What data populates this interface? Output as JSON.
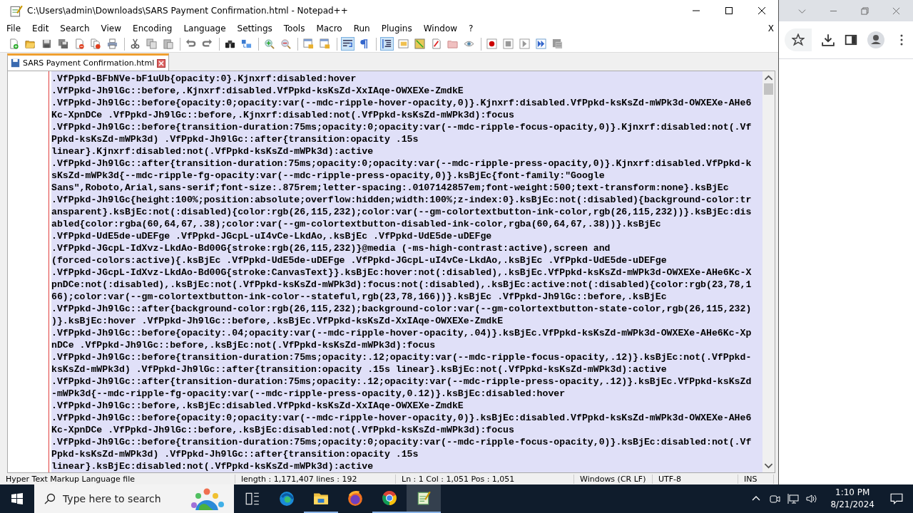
{
  "window": {
    "title": "C:\\Users\\admin\\Downloads\\SARS Payment Confirmation.html - Notepad++"
  },
  "menu": [
    "File",
    "Edit",
    "Search",
    "View",
    "Encoding",
    "Language",
    "Settings",
    "Tools",
    "Macro",
    "Run",
    "Plugins",
    "Window",
    "?"
  ],
  "menu_close": "X",
  "toolbar": [
    {
      "pressed": false
    },
    {
      "pressed": false
    },
    {
      "pressed": false
    },
    {
      "pressed": false
    },
    {
      "pressed": false
    },
    {
      "pressed": false
    },
    {
      "pressed": false
    },
    {
      "pressed": false
    },
    {
      "pressed": false
    },
    {
      "pressed": false
    },
    {
      "pressed": false
    },
    {
      "pressed": false
    },
    {
      "pressed": false
    },
    {
      "pressed": false
    },
    {
      "pressed": false
    },
    {
      "pressed": false
    },
    {
      "pressed": false
    },
    {
      "pressed": false
    },
    {
      "pressed": true
    },
    {
      "pressed": false
    },
    {
      "pressed": true
    },
    {
      "pressed": false
    },
    {
      "pressed": false
    },
    {
      "pressed": false
    },
    {
      "pressed": false
    },
    {
      "pressed": false
    },
    {
      "pressed": false
    },
    {
      "pressed": false
    },
    {
      "pressed": false
    },
    {
      "pressed": false
    },
    {
      "pressed": false
    }
  ],
  "tabs": [
    {
      "label": "SARS Payment Confirmation.html",
      "selected": true
    }
  ],
  "editor": {
    "selected": true,
    "lines": [
      ".VfPpkd-BFbNVe-bF1uUb{opacity:0}.Kjnxrf:disabled:hover",
      ".VfPpkd-Jh9lGc::before,.Kjnxrf:disabled.VfPpkd-ksKsZd-XxIAqe-OWXEXe-ZmdkE",
      ".VfPpkd-Jh9lGc::before{opacity:0;opacity:var(--mdc-ripple-hover-opacity,0)}.Kjnxrf:disabled.VfPpkd-ksKsZd-mWPk3d-OWXEXe-AHe6",
      "Kc-XpnDCe .VfPpkd-Jh9lGc::before,.Kjnxrf:disabled:not(.VfPpkd-ksKsZd-mWPk3d):focus",
      ".VfPpkd-Jh9lGc::before{transition-duration:75ms;opacity:0;opacity:var(--mdc-ripple-focus-opacity,0)}.Kjnxrf:disabled:not(.Vf",
      "Ppkd-ksKsZd-mWPk3d) .VfPpkd-Jh9lGc::after{transition:opacity .15s",
      "linear}.Kjnxrf:disabled:not(.VfPpkd-ksKsZd-mWPk3d):active",
      ".VfPpkd-Jh9lGc::after{transition-duration:75ms;opacity:0;opacity:var(--mdc-ripple-press-opacity,0)}.Kjnxrf:disabled.VfPpkd-k",
      "sKsZd-mWPk3d{--mdc-ripple-fg-opacity:var(--mdc-ripple-press-opacity,0)}.ksBjEc{font-family:\"Google",
      "Sans\",Roboto,Arial,sans-serif;font-size:.875rem;letter-spacing:.0107142857em;font-weight:500;text-transform:none}.ksBjEc",
      ".VfPpkd-Jh9lGc{height:100%;position:absolute;overflow:hidden;width:100%;z-index:0}.ksBjEc:not(:disabled){background-color:tr",
      "ansparent}.ksBjEc:not(:disabled){color:rgb(26,115,232);color:var(--gm-colortextbutton-ink-color,rgb(26,115,232))}.ksBjEc:dis",
      "abled{color:rgba(60,64,67,.38);color:var(--gm-colortextbutton-disabled-ink-color,rgba(60,64,67,.38))}.ksBjEc",
      ".VfPpkd-UdE5de-uDEFge .VfPpkd-JGcpL-uI4vCe-LkdAo,.ksBjEc .VfPpkd-UdE5de-uDEFge",
      ".VfPpkd-JGcpL-IdXvz-LkdAo-Bd00G{stroke:rgb(26,115,232)}@media (-ms-high-contrast:active),screen and",
      "(forced-colors:active){.ksBjEc .VfPpkd-UdE5de-uDEFge .VfPpkd-JGcpL-uI4vCe-LkdAo,.ksBjEc .VfPpkd-UdE5de-uDEFge",
      ".VfPpkd-JGcpL-IdXvz-LkdAo-Bd00G{stroke:CanvasText}}.ksBjEc:hover:not(:disabled),.ksBjEc.VfPpkd-ksKsZd-mWPk3d-OWXEXe-AHe6Kc-X",
      "pnDCe:not(:disabled),.ksBjEc:not(.VfPpkd-ksKsZd-mWPk3d):focus:not(:disabled),.ksBjEc:active:not(:disabled){color:rgb(23,78,1",
      "66);color:var(--gm-colortextbutton-ink-color--stateful,rgb(23,78,166))}.ksBjEc .VfPpkd-Jh9lGc::before,.ksBjEc",
      ".VfPpkd-Jh9lGc::after{background-color:rgb(26,115,232);background-color:var(--gm-colortextbutton-state-color,rgb(26,115,232)",
      ")}.ksBjEc:hover .VfPpkd-Jh9lGc::before,.ksBjEc.VfPpkd-ksKsZd-XxIAqe-OWXEXe-ZmdkE",
      ".VfPpkd-Jh9lGc::before{opacity:.04;opacity:var(--mdc-ripple-hover-opacity,.04)}.ksBjEc.VfPpkd-ksKsZd-mWPk3d-OWXEXe-AHe6Kc-Xp",
      "nDCe .VfPpkd-Jh9lGc::before,.ksBjEc:not(.VfPpkd-ksKsZd-mWPk3d):focus",
      ".VfPpkd-Jh9lGc::before{transition-duration:75ms;opacity:.12;opacity:var(--mdc-ripple-focus-opacity,.12)}.ksBjEc:not(.VfPpkd-",
      "ksKsZd-mWPk3d) .VfPpkd-Jh9lGc::after{transition:opacity .15s linear}.ksBjEc:not(.VfPpkd-ksKsZd-mWPk3d):active",
      ".VfPpkd-Jh9lGc::after{transition-duration:75ms;opacity:.12;opacity:var(--mdc-ripple-press-opacity,.12)}.ksBjEc.VfPpkd-ksKsZd",
      "-mWPk3d{--mdc-ripple-fg-opacity:var(--mdc-ripple-press-opacity,0.12)}.ksBjEc:disabled:hover",
      ".VfPpkd-Jh9lGc::before,.ksBjEc:disabled.VfPpkd-ksKsZd-XxIAqe-OWXEXe-ZmdkE",
      ".VfPpkd-Jh9lGc::before{opacity:0;opacity:var(--mdc-ripple-hover-opacity,0)}.ksBjEc:disabled.VfPpkd-ksKsZd-mWPk3d-OWXEXe-AHe6",
      "Kc-XpnDCe .VfPpkd-Jh9lGc::before,.ksBjEc:disabled:not(.VfPpkd-ksKsZd-mWPk3d):focus",
      ".VfPpkd-Jh9lGc::before{transition-duration:75ms;opacity:0;opacity:var(--mdc-ripple-focus-opacity,0)}.ksBjEc:disabled:not(.Vf",
      "Ppkd-ksKsZd-mWPk3d) .VfPpkd-Jh9lGc::after{transition:opacity .15s",
      "linear}.ksBjEc:disabled:not(.VfPpkd-ksKsZd-mWPk3d):active"
    ]
  },
  "status_bar": [
    "Hyper Text Markup Language file",
    "length : 1,171,407    lines : 192",
    "Ln : 1    Col : 1,051    Pos : 1,051",
    "Windows (CR LF)",
    "UTF-8",
    "INS"
  ],
  "taskbar": {
    "search": {
      "placeholder": "Type here to search"
    },
    "apps": [
      {
        "running": false,
        "selected": false
      },
      {
        "running": false,
        "selected": false
      },
      {
        "running": true,
        "selected": false
      },
      {
        "running": false,
        "selected": false
      },
      {
        "running": true,
        "selected": false
      },
      {
        "running": true,
        "selected": true
      }
    ],
    "clock": {
      "time": "1:10 PM",
      "date": "8/21/2024"
    }
  }
}
